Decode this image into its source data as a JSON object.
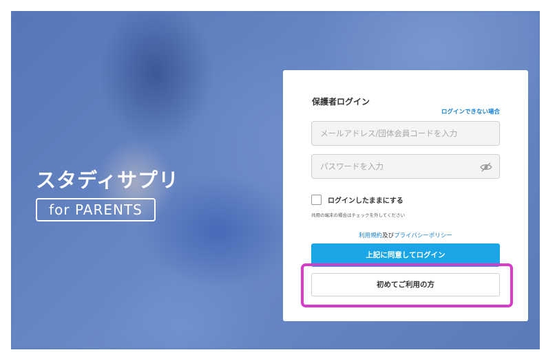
{
  "brand": {
    "logo_main": "スタディサプリ",
    "logo_sub": "for PARENTS"
  },
  "login": {
    "title": "保護者ログイン",
    "help_link": "ログインできない場合",
    "email_placeholder": "メールアドレス/団体会員コードを入力",
    "password_placeholder": "パスワードを入力",
    "remember_label": "ログインしたままにする",
    "remember_note": "共用の端末の場合はチェックを外してください",
    "terms_link": "利用規約",
    "terms_connector": "及び",
    "privacy_link": "プライバシーポリシー",
    "login_button": "上記に同意してログイン",
    "first_time_button": "初めてご利用の方"
  },
  "colors": {
    "accent": "#1aa5e6",
    "link": "#1a84d6",
    "highlight": "#d63bc9",
    "background": "#5d7cbc"
  },
  "icons": {
    "password_toggle": "eye-slash-icon"
  }
}
